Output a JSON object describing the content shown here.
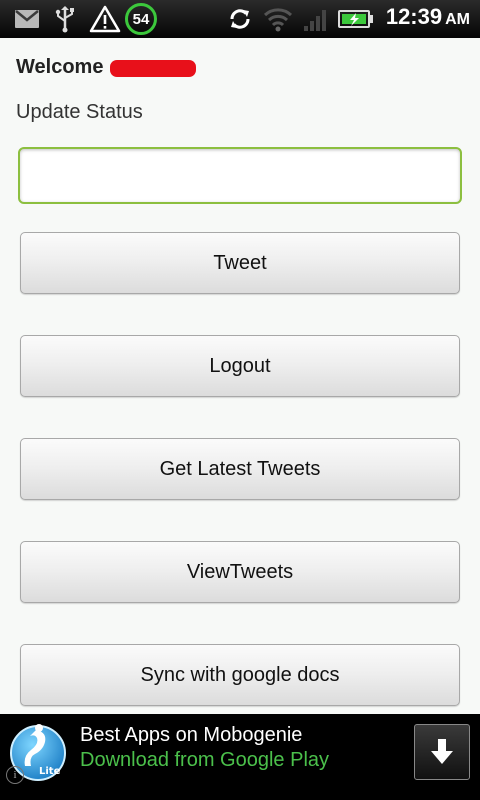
{
  "status_bar": {
    "icons": [
      "gmail-icon",
      "usb-icon",
      "warning-icon",
      "notification-count-icon",
      "sync-icon",
      "wifi-icon",
      "signal-icon",
      "battery-charging-icon"
    ],
    "notification_count": "54",
    "time": "12:39",
    "ampm": "AM",
    "colors": {
      "background": "#000000",
      "battery": "#3cc83c"
    }
  },
  "header": {
    "welcome": "Welcome"
  },
  "form": {
    "status_label": "Update Status",
    "status_value": "",
    "accent_color": "#8cbf3f"
  },
  "buttons": {
    "tweet": "Tweet",
    "logout": "Logout",
    "get_latest": "Get Latest Tweets",
    "view_tweets": "ViewTweets",
    "sync": "Sync with google docs"
  },
  "ad": {
    "title": "Best Apps on Mobogenie",
    "subtitle": "Download from Google Play",
    "icon_badge": "Lite",
    "info_glyph": "i",
    "subtitle_color": "#4bc04b"
  }
}
